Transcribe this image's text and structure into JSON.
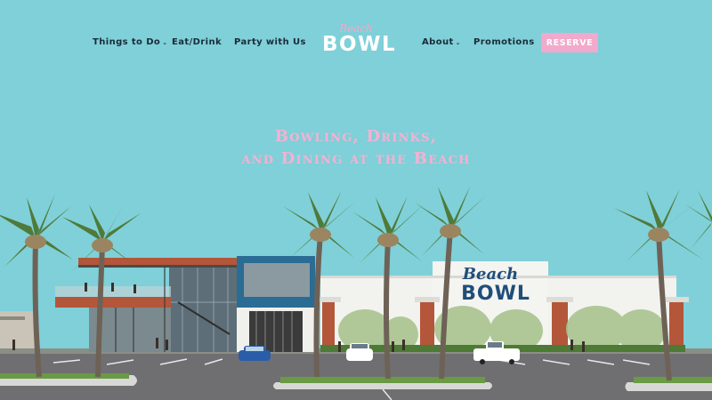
{
  "nav": {
    "things_to_do": "Things to Do",
    "eat_drink": "Eat/Drink",
    "party": "Party with Us",
    "about": "About",
    "promotions": "Promotions",
    "reserve": "RESERVE",
    "caret": "⌄"
  },
  "logo": {
    "script": "Beach",
    "word": "BOWL"
  },
  "hero": {
    "line1": "Bowling, Drinks,",
    "line2": "and Dining at the Beach"
  },
  "building_sign": {
    "script": "Beach",
    "word": "BOWL"
  },
  "colors": {
    "sky": "#7fd0d8",
    "pink": "#f2a9cb",
    "navy": "#1c2a3a",
    "sign_blue": "#1f4e79"
  }
}
